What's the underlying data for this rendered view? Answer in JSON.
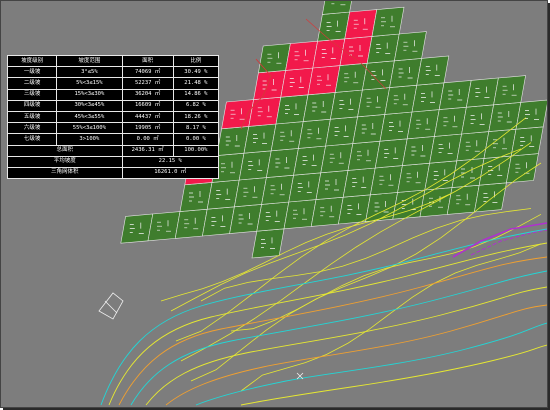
{
  "legend": {
    "header": [
      "坡度级别",
      "坡度范围",
      "面积",
      "比例"
    ],
    "rows": [
      [
        "一级坡",
        "3°≤5%",
        "74069 ㎡",
        "30.49 %"
      ],
      [
        "二级坡",
        "5%<3≤15%",
        "52237 ㎡",
        "21.48 %"
      ],
      [
        "三级坡",
        "15%<3≤30%",
        "36204 ㎡",
        "14.86 %"
      ],
      [
        "四级坡",
        "30%<3≤45%",
        "16609 ㎡",
        "6.82 %"
      ],
      [
        "五级坡",
        "45%<3≤55%",
        "44437 ㎡",
        "18.26 %"
      ],
      [
        "六级坡",
        "55%<3≤100%",
        "19905 ㎡",
        "8.17 %"
      ],
      [
        "七级坡",
        "3>100%",
        "0.00 ㎡",
        "0.00 %"
      ]
    ],
    "total_label": "总面积",
    "total_area": "2436.31 ㎡",
    "total_ratio": "100.00%",
    "avg_label": "平均坡度",
    "avg_value": "22.15 %",
    "volume_label": "三角网体积",
    "volume_value": "16261.0 ㎥"
  },
  "colors": {
    "background": "#7d7d7d",
    "cell_green": "#3f7d2d",
    "cell_red": "#f2194b",
    "grid_line": "#e6e6e6",
    "contour_yellow": "#e6e832",
    "contour_cyan": "#22d6d6",
    "contour_orange": "#f0a030",
    "boundary_purple": "#b030d0"
  }
}
